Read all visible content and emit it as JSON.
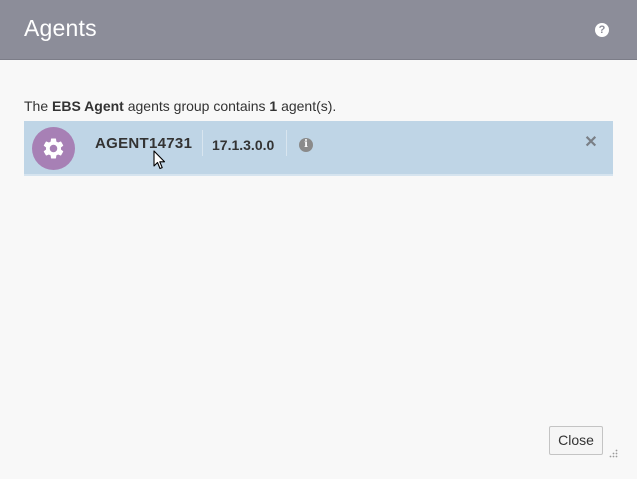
{
  "dialog": {
    "title": "Agents",
    "help_icon": "question-circle-icon",
    "summary": {
      "prefix": "The ",
      "group_name": "EBS Agent",
      "middle": " agents group contains ",
      "count": "1",
      "suffix": " agent(s)."
    },
    "agents": [
      {
        "name": "AGENT14731",
        "version": "17.1.3.0.0",
        "avatar_icon": "gear-icon",
        "avatar_color": "#a780b5",
        "info_icon": "info-icon",
        "remove_icon": "close-icon"
      }
    ],
    "close_label": "Close"
  },
  "colors": {
    "header_bg": "#8c8d99",
    "row_selected_bg": "#bfd5e6",
    "page_bg": "#f8f8f8"
  }
}
